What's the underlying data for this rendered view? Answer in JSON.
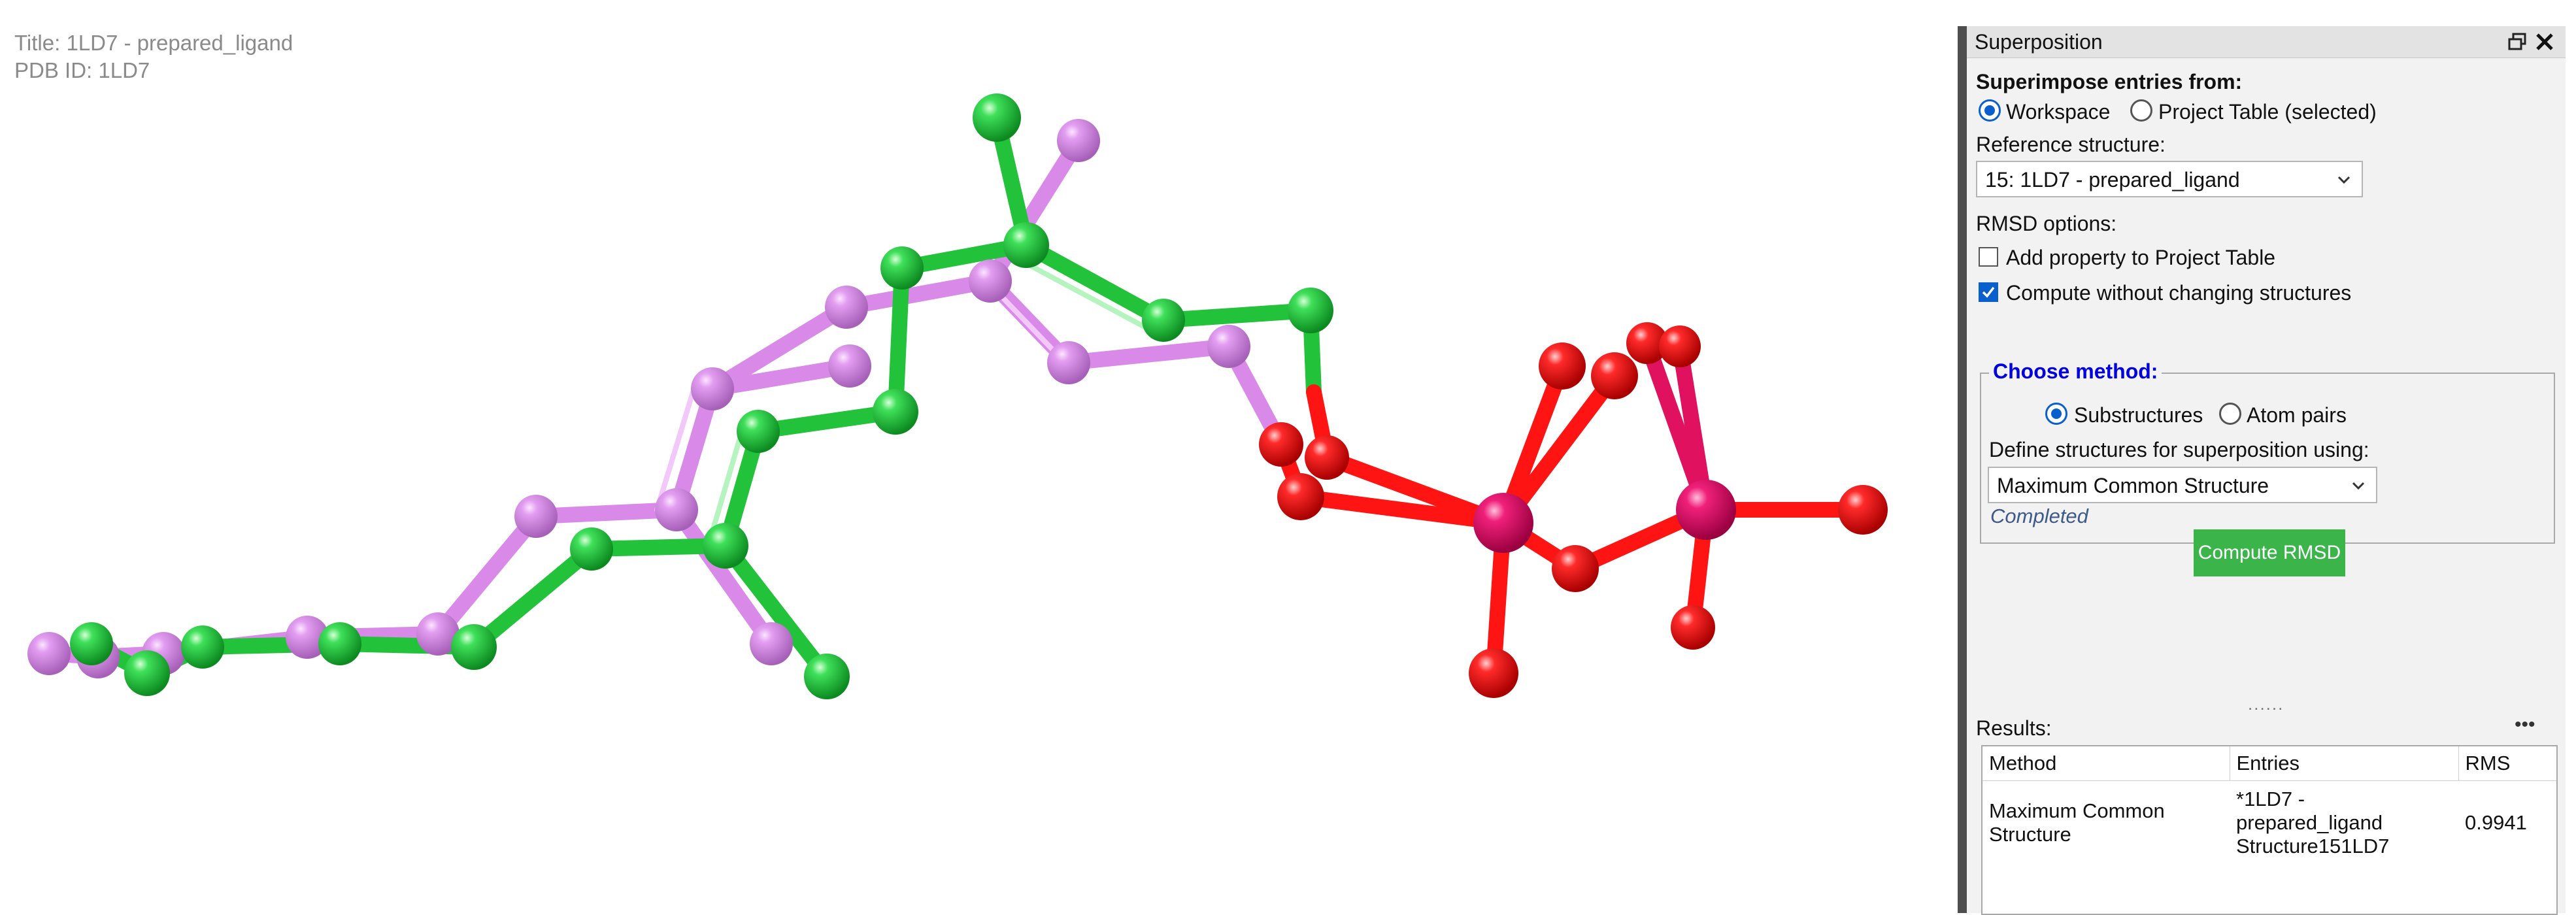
{
  "viewport": {
    "title_line": "Title: 1LD7 - prepared_ligand",
    "pdb_line": "PDB ID: 1LD7"
  },
  "panel": {
    "title": "Superposition",
    "superimpose_label": "Superimpose entries from:",
    "source_options": [
      "Workspace",
      "Project Table (selected)"
    ],
    "source_selected": "Workspace",
    "reference_label": "Reference structure:",
    "reference_value": "15: 1LD7 - prepared_ligand",
    "rmsd_options_label": "RMSD options:",
    "checkboxes": [
      {
        "label": "Add property to Project Table",
        "checked": false
      },
      {
        "label": "Compute without changing structures",
        "checked": true
      }
    ],
    "method_group_title": "Choose method:",
    "method_options": [
      "Substructures",
      "Atom pairs"
    ],
    "method_selected": "Substructures",
    "define_label": "Define structures for superposition using:",
    "define_value": "Maximum Common Structure",
    "status": "Completed",
    "compute_button": "Compute RMSD",
    "splitter": "......",
    "results_label": "Results:",
    "results_menu": "•••",
    "results": {
      "columns": [
        "Method",
        "Entries",
        "RMS"
      ],
      "rows": [
        {
          "method": [
            "Maximum Common",
            "Structure"
          ],
          "entries": [
            "*1LD7 -",
            "prepared_ligand",
            "Structure151LD7"
          ],
          "rms": "0.9941"
        }
      ]
    }
  },
  "colors": {
    "carbon_green": "#22c23a",
    "carbon_violet": "#d98ae8",
    "oxygen": "#ff1414",
    "phosphorus": "#e0115f",
    "accent_blue": "#0a5fcf",
    "button_green": "#3bb54a",
    "group_title_blue": "#0000e0"
  },
  "icon_names": [
    "restore-window-icon",
    "close-icon",
    "chevron-down-icon",
    "checkmark-icon"
  ]
}
